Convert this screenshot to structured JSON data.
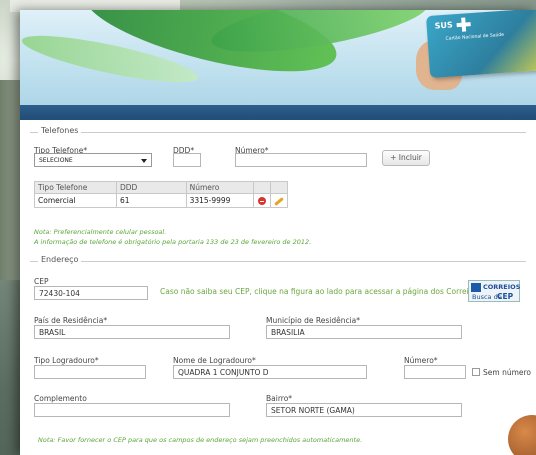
{
  "brand": {
    "card_logo": "SUS",
    "card_subtitle": "Cartão Nacional de Saúde"
  },
  "telefones": {
    "legend": "Telefones",
    "tipo_label": "Tipo Telefone*",
    "tipo_value": "SELECIONE",
    "ddd_label": "DDD*",
    "ddd_value": "",
    "numero_label": "Número*",
    "numero_value": "",
    "incluir_label": "+ Incluir",
    "table": {
      "headers": [
        "Tipo Telefone",
        "DDD",
        "Número"
      ],
      "rows": [
        {
          "tipo": "Comercial",
          "ddd": "61",
          "numero": "3315-9999"
        }
      ]
    },
    "note1": "Nota: Preferencialmente celular pessoal.",
    "note2": "A informação de telefone é obrigatório pela portaria 133 de 23 de fevereiro de 2012."
  },
  "endereco": {
    "legend": "Endereço",
    "cep_label": "CEP",
    "cep_value": "72430-104",
    "cep_hint": "Caso não saiba seu CEP, clique na figura ao lado para acessar a página dos Correios.",
    "correios_top": "CORREIOS",
    "correios_busca": "Busca de",
    "correios_cep": "CEP",
    "pais_label": "País de Residência*",
    "pais_value": "BRASIL",
    "municipio_label": "Município de Residência*",
    "municipio_value": "BRASILIA",
    "tipo_log_label": "Tipo Logradouro*",
    "tipo_log_value": "",
    "nome_log_label": "Nome de Logradouro*",
    "nome_log_value": "QUADRA 1 CONJUNTO D",
    "numero_label": "Número*",
    "numero_value": "",
    "sem_numero_label": "Sem número",
    "complemento_label": "Complemento",
    "complemento_value": "",
    "bairro_label": "Bairro*",
    "bairro_value": "SETOR NORTE (GAMA)",
    "note": "Nota: Favor fornecer o CEP para que os campos de endereço sejam preenchidos automaticamente."
  },
  "colors": {
    "accent_green": "#5aa63a",
    "header_bar": "#1f4a72",
    "delete_red": "#d9342b",
    "edit_orange": "#e8a524"
  }
}
